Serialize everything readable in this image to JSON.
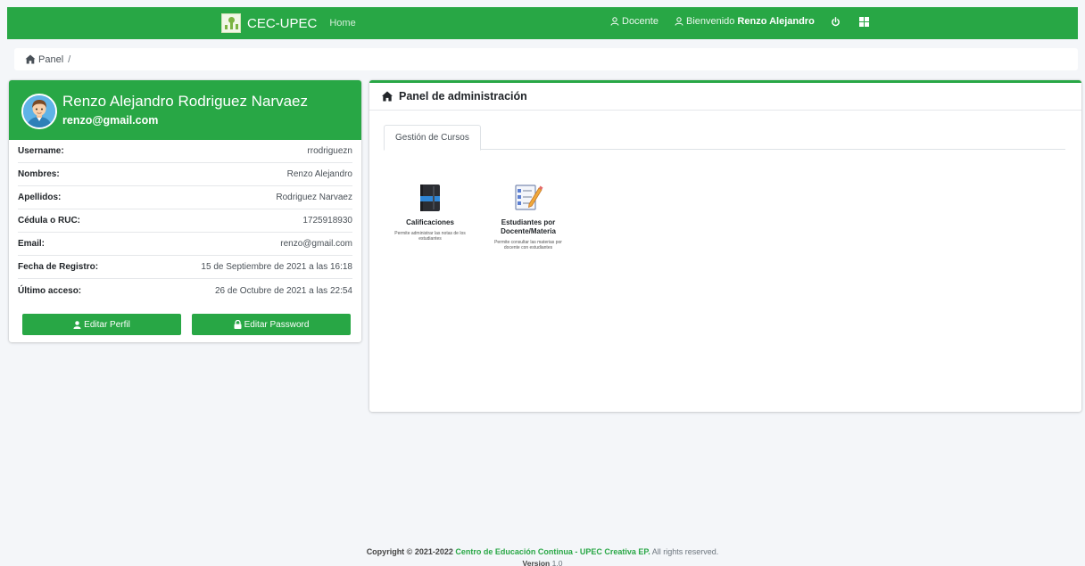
{
  "navbar": {
    "brand": "CEC-UPEC",
    "home": "Home",
    "docente": "Docente",
    "welcome": "Bienvenido",
    "user_name": "Renzo Alejandro"
  },
  "breadcrumb": {
    "panel": "Panel",
    "separator": "/"
  },
  "profile": {
    "name": "Renzo Alejandro Rodriguez Narvaez",
    "email": "renzo@gmail.com",
    "rows": [
      {
        "label": "Username:",
        "value": "rrodriguezn"
      },
      {
        "label": "Nombres:",
        "value": "Renzo Alejandro"
      },
      {
        "label": "Apellidos:",
        "value": "Rodriguez Narvaez"
      },
      {
        "label": "Cédula o RUC:",
        "value": "1725918930"
      },
      {
        "label": "Email:",
        "value": "renzo@gmail.com"
      },
      {
        "label": "Fecha de Registro:",
        "value": "15 de Septiembre de 2021 a las 16:18"
      },
      {
        "label": "Último acceso:",
        "value": "26 de Octubre de 2021 a las 22:54"
      }
    ],
    "edit_profile": "Editar Perfil",
    "edit_password": "Editar Password"
  },
  "admin": {
    "title": "Panel de administración",
    "tab": "Gestión de Cursos",
    "tiles": [
      {
        "title": "Calificaciones",
        "desc": "Permite administrar las notas de los estudiantes"
      },
      {
        "title": "Estudiantes por Docente/Materia",
        "desc": "Permite consultar las materias por docente con estudiantes"
      }
    ]
  },
  "footer": {
    "copyright": "Copyright © 2021-2022",
    "org": "Centro de Educación Continua - UPEC Creativa EP.",
    "rights": "All rights reserved.",
    "version_label": "Version",
    "version": "1.0"
  },
  "colors": {
    "accent": "#28a745",
    "background": "#f4f6f9"
  },
  "icons": [
    "logo-icon",
    "user-icon",
    "power-icon",
    "grid-icon",
    "home-icon",
    "lock-icon",
    "notebook-icon",
    "checklist-icon"
  ]
}
